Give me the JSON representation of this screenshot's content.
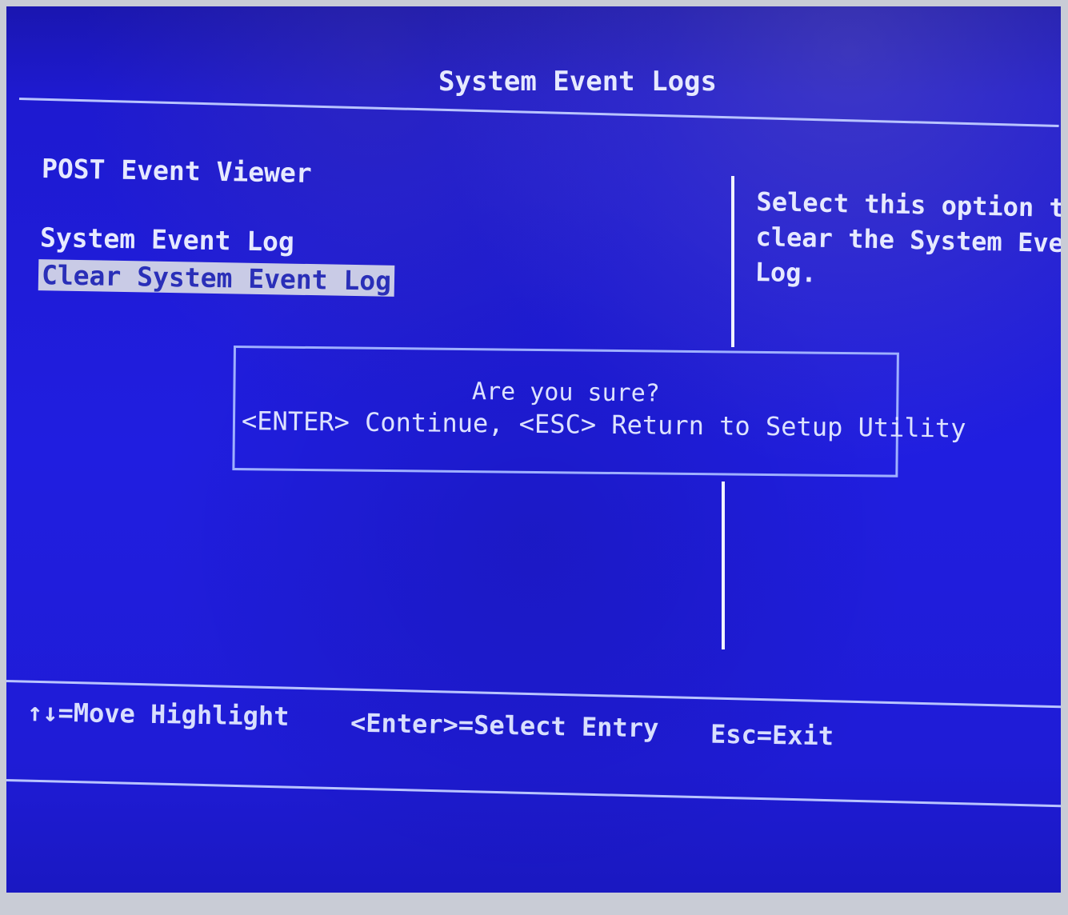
{
  "header": {
    "title": "System Event Logs"
  },
  "menu": {
    "items": [
      {
        "label": "POST Event Viewer"
      },
      {
        "label": "System Event Log"
      },
      {
        "label": "Clear System Event Log"
      }
    ],
    "selected_index": 2
  },
  "help": {
    "lines": [
      "Select this option to",
      "clear the System Event",
      "Log."
    ]
  },
  "dialog": {
    "question": "Are you sure?",
    "options_text": "<ENTER> Continue, <ESC> Return to Setup Utility"
  },
  "footer": {
    "move": "↑↓=Move Highlight",
    "select": "<Enter>=Select Entry",
    "exit": "Esc=Exit"
  },
  "colors": {
    "background": "#1f1cd6",
    "text": "#e6e9ff",
    "highlight_bg": "#c9cbe6",
    "highlight_text": "#2a2fb8"
  }
}
